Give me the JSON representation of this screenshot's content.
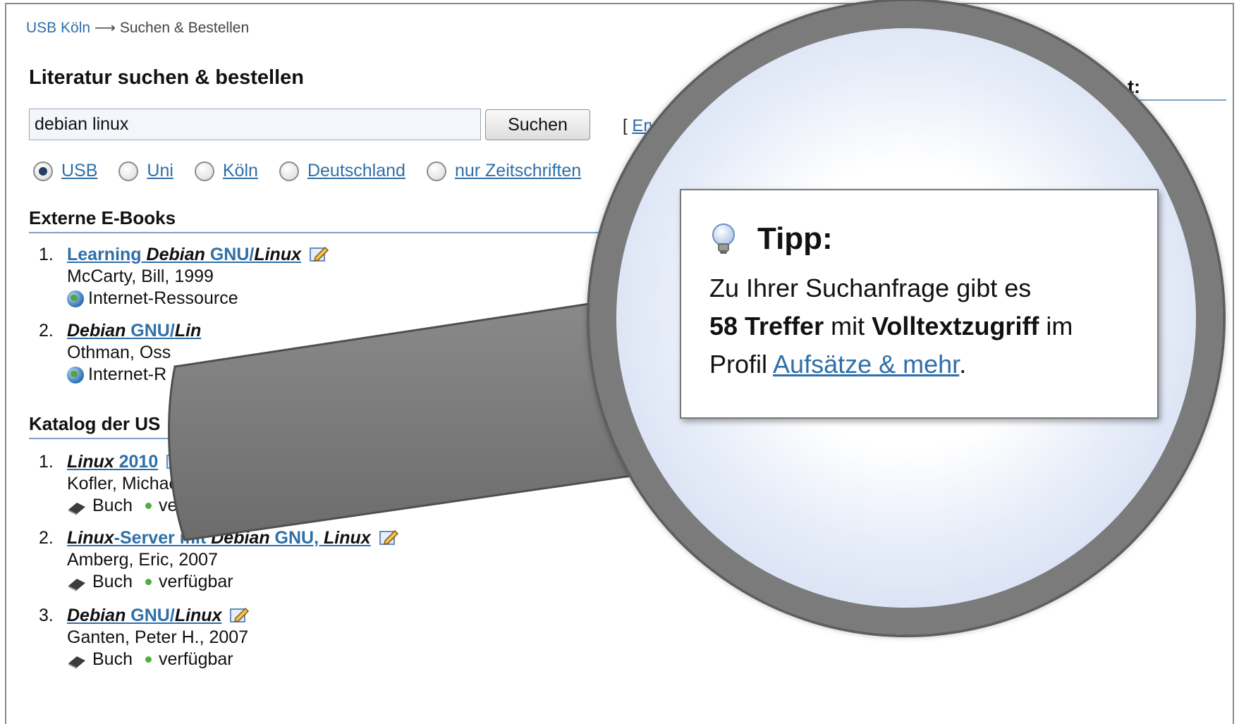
{
  "breadcrumb": {
    "home": "USB Köln",
    "separator": " ⟶ ",
    "current": "Suchen & Bestellen"
  },
  "page_title": "Literatur suchen & bestellen",
  "search": {
    "value": "debian linux",
    "button_label": "Suchen",
    "extended_prefix": "[ ",
    "extended_link": "Erw"
  },
  "scopes": [
    {
      "label": "USB",
      "checked": true
    },
    {
      "label": "Uni",
      "checked": false
    },
    {
      "label": "Köln",
      "checked": false
    },
    {
      "label": "Deutschland",
      "checked": false
    },
    {
      "label": "nur Zeitschriften",
      "checked": false
    }
  ],
  "right_heading": "t:",
  "ebooks": {
    "heading": "Externe E-Books",
    "items": [
      {
        "num": "1.",
        "t1": "Learning ",
        "t2": "Debian",
        "t3": " GNU/",
        "t4": "Linux",
        "author": "McCarty, Bill, 1999",
        "type": "Internet-Ressource"
      },
      {
        "num": "2.",
        "t1": "",
        "t2": "Debian",
        "t3": " GNU/",
        "t4": "Lin",
        "author": "Othman, Oss",
        "type": "Internet-R"
      }
    ]
  },
  "catalog": {
    "heading": "Katalog der US",
    "items": [
      {
        "num": "1.",
        "t1": "",
        "t2": "Linux",
        "t3": " 2010",
        "t4": "",
        "author": "Kofler, Michael,",
        "type": "Buch",
        "status": "verfügbar"
      },
      {
        "num": "2.",
        "t1": "",
        "t2": "Linux",
        "t3": "-Server mit ",
        "t4": "Debian",
        "t5": " GNU, ",
        "t6": "Linux",
        "author": "Amberg, Eric, 2007",
        "type": "Buch",
        "status": "verfügbar"
      },
      {
        "num": "3.",
        "t1": "",
        "t2": "Debian",
        "t3": " GNU/",
        "t4": "Linux",
        "author": "Ganten, Peter H., 2007",
        "type": "Buch",
        "status": "verfügbar"
      }
    ]
  },
  "tip": {
    "heading": "Tipp:",
    "line1": "Zu Ihrer Suchanfrage gibt es",
    "count": "58 Treffer",
    "mid": " mit ",
    "fulltext": "Volltextzugriff",
    "after": " im",
    "line3_prefix": "Profil ",
    "link": "Aufsätze & mehr",
    "line3_suffix": "."
  },
  "colors": {
    "link": "#2f6fa8",
    "section_rule": "#7fa2c4",
    "magnifier": "#7b7b7b",
    "available": "#4fae3e"
  }
}
